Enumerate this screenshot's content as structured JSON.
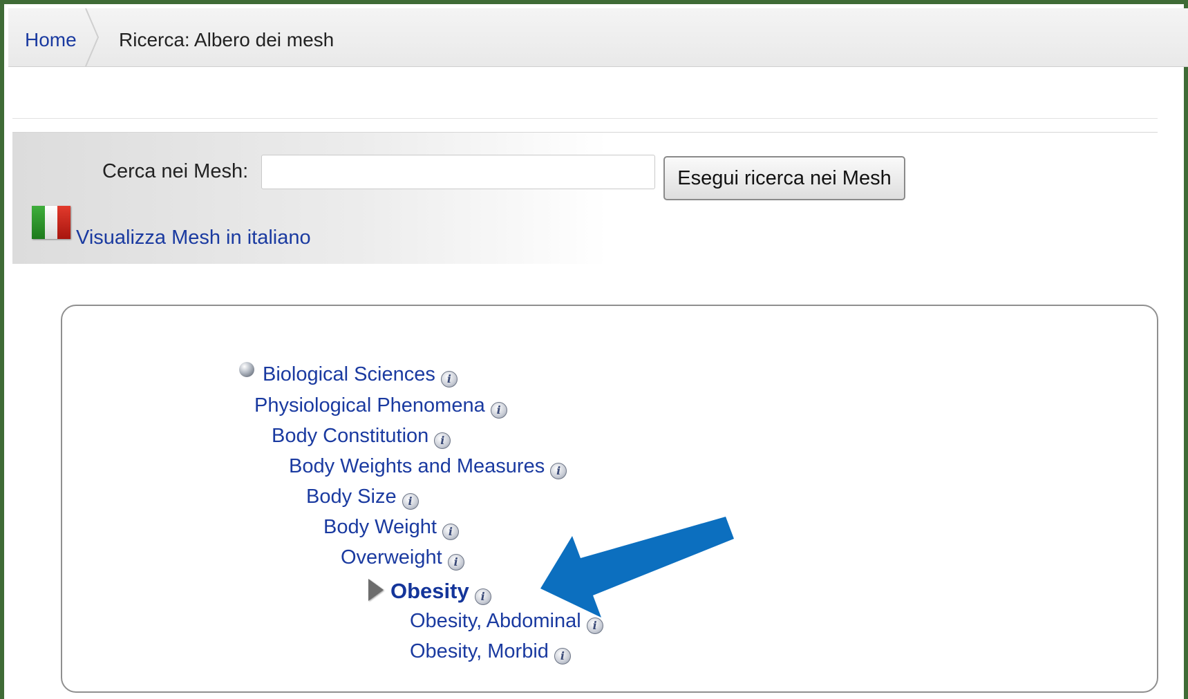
{
  "breadcrumb": {
    "home": "Home",
    "current": "Ricerca: Albero dei mesh"
  },
  "search": {
    "label": "Cerca nei Mesh:",
    "value": "",
    "placeholder": "",
    "button_label": "Esegui ricerca nei Mesh"
  },
  "language": {
    "flag_icon": "italian-flag-icon",
    "link_label": "Visualizza Mesh in italiano"
  },
  "tree": {
    "items": [
      {
        "label": "Biological Sciences"
      },
      {
        "label": "Physiological Phenomena"
      },
      {
        "label": "Body Constitution"
      },
      {
        "label": "Body Weights and Measures"
      },
      {
        "label": "Body Size"
      },
      {
        "label": "Body Weight"
      },
      {
        "label": "Overweight"
      },
      {
        "label": "Obesity",
        "current": true
      },
      {
        "label": "Obesity, Abdominal"
      },
      {
        "label": "Obesity, Morbid"
      }
    ],
    "info_glyph": "i"
  },
  "colors": {
    "frame_border": "#3f6b36",
    "link": "#1a3aa0",
    "annotation_arrow": "#0c6fbf"
  }
}
